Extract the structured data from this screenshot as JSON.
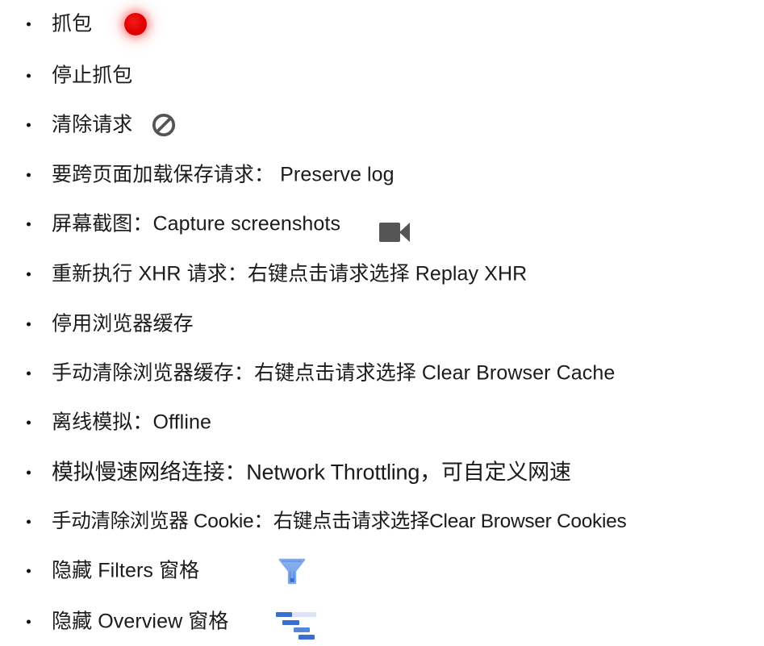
{
  "page": {
    "background_color": "#ffffff",
    "text_color": "#1b1b1b",
    "bullet_color": "#111111"
  },
  "colors": {
    "record_red": "#e00000",
    "block_gray": "#555558",
    "camera_gray": "#555558",
    "funnel_blue": "#3f7fe0",
    "funnel_blue_light": "#b9cdf2",
    "waterfall_blue": "#3a6fd0",
    "waterfall_blue_pale": "#cfdcf4"
  },
  "bullets": [
    {
      "text": "抓包",
      "icon": "record-dot-icon",
      "has_icon": true
    },
    {
      "text": "停止抓包",
      "icon": null,
      "has_icon": false
    },
    {
      "text": "清除请求",
      "icon": "clear-block-icon",
      "has_icon": true
    },
    {
      "text": "要跨页面加载保存请求：  Preserve log",
      "icon": null,
      "has_icon": false
    },
    {
      "text": "屏幕截图：Capture screenshots",
      "icon": "video-camera-icon",
      "has_icon": true
    },
    {
      "text": "重新执行 XHR 请求：右键点击请求选择 Replay XHR",
      "icon": null,
      "has_icon": false
    },
    {
      "text": "停用浏览器缓存",
      "icon": null,
      "has_icon": false
    },
    {
      "text": "手动清除浏览器缓存：右键点击请求选择 Clear Browser Cache",
      "icon": null,
      "has_icon": false
    },
    {
      "text": "离线模拟：Offline",
      "icon": null,
      "has_icon": false
    },
    {
      "text": "模拟慢速网络连接：Network Throttling，可自定义网速",
      "icon": null,
      "has_icon": false
    },
    {
      "text": "手动清除浏览器 Cookie：右键点击请求选择Clear Browser Cookies",
      "icon": null,
      "has_icon": false
    },
    {
      "text": "隐藏 Filters 窗格",
      "icon": "filter-funnel-icon",
      "has_icon": true
    },
    {
      "text": "隐藏 Overview 窗格",
      "icon": "overview-waterfall-icon",
      "has_icon": true
    }
  ]
}
